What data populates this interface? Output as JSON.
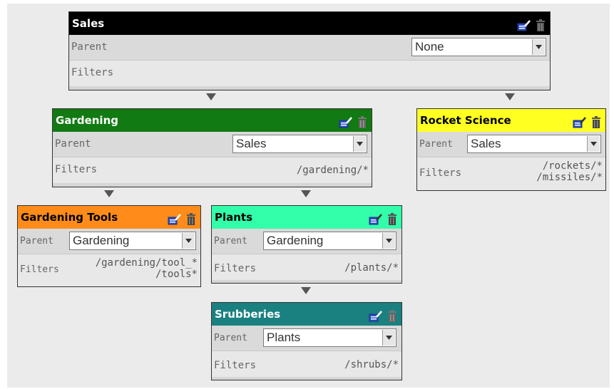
{
  "labels": {
    "parent": "Parent",
    "filters": "Filters"
  },
  "icons": {
    "edit": "edit-icon",
    "delete": "trash-icon",
    "connector": "down-arrow-icon"
  },
  "nodes": {
    "sales": {
      "title": "Sales",
      "header_color": "#000000",
      "title_color": "#ffffff",
      "parent": "None",
      "filters": []
    },
    "gardening": {
      "title": "Gardening",
      "header_color": "#127a12",
      "title_color": "#ffffff",
      "parent": "Sales",
      "filters": [
        "/gardening/*"
      ]
    },
    "rocket_science": {
      "title": "Rocket Science",
      "header_color": "#ffff22",
      "title_color": "#000000",
      "parent": "Sales",
      "filters": [
        "/rockets/*",
        "/missiles/*"
      ]
    },
    "gardening_tools": {
      "title": "Gardening Tools",
      "header_color": "#ff8c1a",
      "title_color": "#000000",
      "parent": "Gardening",
      "filters": [
        "/gardening/tool_*",
        "/tools*"
      ]
    },
    "plants": {
      "title": "Plants",
      "header_color": "#33ffaa",
      "title_color": "#000000",
      "parent": "Gardening",
      "filters": [
        "/plants/*"
      ]
    },
    "srubberies": {
      "title": "Srubberies",
      "header_color": "#1a8080",
      "title_color": "#ffffff",
      "parent": "Plants",
      "filters": [
        "/shrubs/*"
      ]
    }
  }
}
